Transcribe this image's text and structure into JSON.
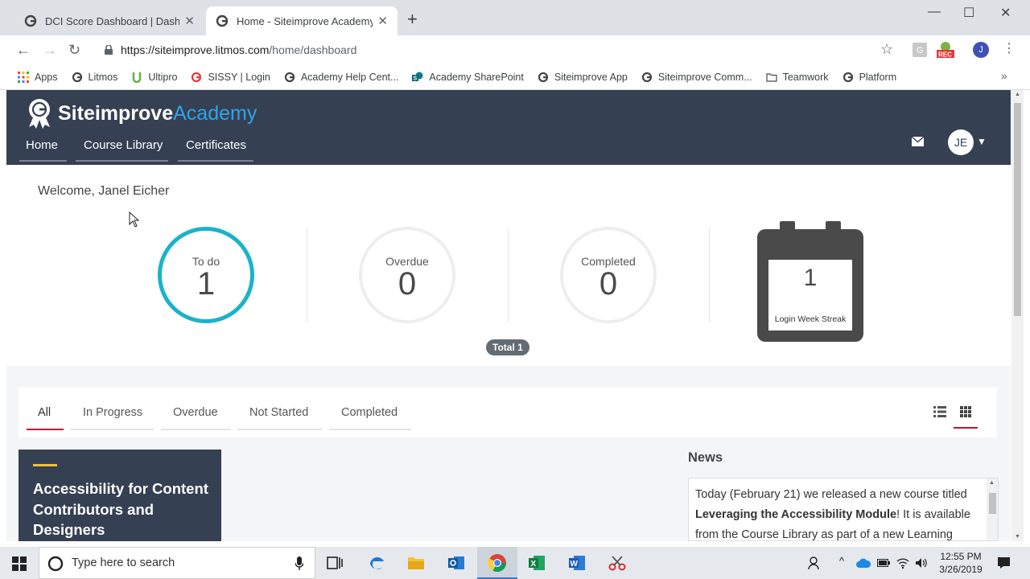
{
  "browser": {
    "tabs": [
      {
        "title": "DCI Score Dashboard | Dashboard",
        "active": false
      },
      {
        "title": "Home - Siteimprove Academy",
        "active": true
      }
    ],
    "url_host": "https://siteimprove.litmos.com",
    "url_path": "/home/dashboard",
    "profile_initial": "J",
    "bookmarks": [
      "Apps",
      "Litmos",
      "Ultipro",
      "SISSY | Login",
      "Academy Help Cent...",
      "Academy SharePoint",
      "Siteimprove App",
      "Siteimprove Comm...",
      "Teamwork",
      "Platform"
    ]
  },
  "site": {
    "brand_primary": "Siteimprove",
    "brand_secondary": "Academy",
    "nav": [
      "Home",
      "Course Library",
      "Certificates"
    ],
    "user_initials": "JE"
  },
  "dashboard": {
    "welcome": "Welcome, Janel Eicher",
    "stats": [
      {
        "label": "To do",
        "value": "1"
      },
      {
        "label": "Overdue",
        "value": "0"
      },
      {
        "label": "Completed",
        "value": "0"
      }
    ],
    "total": "Total 1",
    "streak_value": "1",
    "streak_label": "Login Week Streak"
  },
  "filters": [
    "All",
    "In Progress",
    "Overdue",
    "Not Started",
    "Completed"
  ],
  "course": {
    "title": "Accessibility for Content Contributors and Designers"
  },
  "news": {
    "heading": "News",
    "text_before": "Today (February 21) we released a new course titled ",
    "text_bold": "Leveraging the Accessibility Module",
    "text_after": "! It is available from the Course Library as part of a new Learning"
  },
  "taskbar": {
    "search_placeholder": "Type here to search",
    "time": "12:55 PM",
    "date": "3/26/2019"
  },
  "colors": {
    "header": "#354052",
    "accent_teal": "#1ab3c8",
    "accent_red": "#c8102e",
    "brand_blue": "#2fa4e7"
  }
}
